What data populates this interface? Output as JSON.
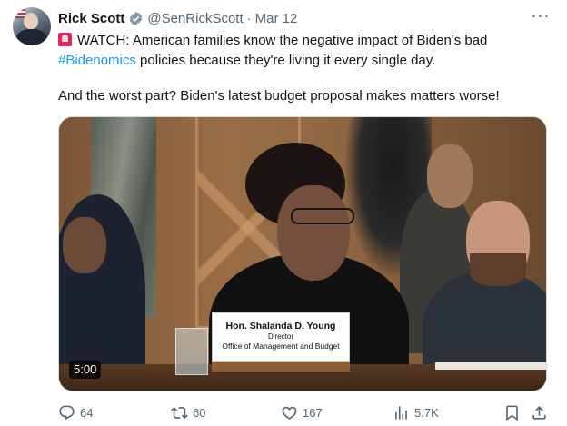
{
  "tweet": {
    "author_name": "Rick Scott",
    "handle": "@SenRickScott",
    "separator": "·",
    "date": "Mar 12",
    "more_label": "···",
    "text_line1_before": "WATCH: American families know the negative impact of Biden's bad",
    "hashtag": "#Bidenomics",
    "text_line2_after": " policies because they're living it every single day.",
    "text_paragraph2": "And the worst part? Biden's latest budget proposal makes matters worse!"
  },
  "video": {
    "duration": "5:00",
    "nameplate": {
      "name": "Hon. Shalanda D. Young",
      "title": "Director",
      "org": "Office of Management and Budget"
    }
  },
  "actions": {
    "replies": "64",
    "retweets": "60",
    "likes": "167",
    "views": "5.7K"
  },
  "colors": {
    "accent": "#1d9bf0",
    "text": "#0f1419",
    "secondary": "#536471",
    "verified_badge": "#829aab"
  },
  "icons": [
    "siren-emoji-icon",
    "verified-badge-icon",
    "more-icon",
    "reply-icon",
    "retweet-icon",
    "like-icon",
    "views-icon",
    "bookmark-icon",
    "share-icon"
  ]
}
